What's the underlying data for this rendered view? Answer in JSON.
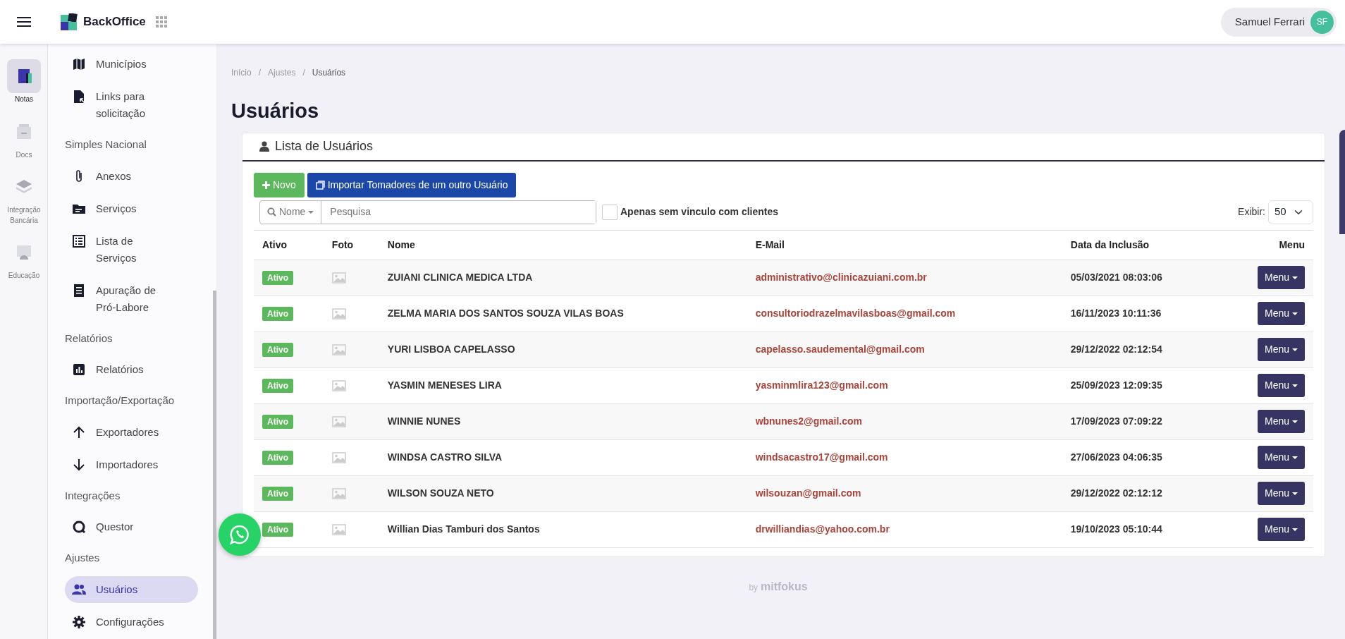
{
  "header": {
    "app_name": "BackOffice",
    "user": {
      "name": "Samuel Ferrari",
      "initials": "SF"
    }
  },
  "rail": [
    {
      "label": "Notas",
      "selected": true
    },
    {
      "label": "Docs",
      "selected": false
    },
    {
      "label": "Integração Bancária",
      "selected": false
    },
    {
      "label": "Educação",
      "selected": false
    }
  ],
  "sidebar": [
    {
      "kind": "item",
      "label": "Municípios",
      "selected": false
    },
    {
      "kind": "item",
      "label": "Links para solicitação",
      "selected": false
    },
    {
      "kind": "heading",
      "label": "Simples Nacional"
    },
    {
      "kind": "item",
      "label": "Anexos",
      "selected": false
    },
    {
      "kind": "item",
      "label": "Serviços",
      "selected": false
    },
    {
      "kind": "item",
      "label": "Lista de Serviços",
      "selected": false
    },
    {
      "kind": "item",
      "label": "Apuração de Pró-Labore",
      "selected": false
    },
    {
      "kind": "heading",
      "label": "Relatórios"
    },
    {
      "kind": "item",
      "label": "Relatórios",
      "selected": false
    },
    {
      "kind": "heading",
      "label": "Importação/Exportação"
    },
    {
      "kind": "item",
      "label": "Exportadores",
      "selected": false
    },
    {
      "kind": "item",
      "label": "Importadores",
      "selected": false
    },
    {
      "kind": "heading",
      "label": "Integrações"
    },
    {
      "kind": "item",
      "label": "Questor",
      "selected": false
    },
    {
      "kind": "heading",
      "label": "Ajustes"
    },
    {
      "kind": "item",
      "label": "Usuários",
      "selected": true
    },
    {
      "kind": "item",
      "label": "Configurações",
      "selected": false
    }
  ],
  "breadcrumb": {
    "separator": "/",
    "items": [
      "Início",
      "Ajustes",
      "Usuários"
    ]
  },
  "page_title": "Usuários",
  "card": {
    "title": "Lista de Usuários",
    "buttons": [
      {
        "kind": "new",
        "label": "Novo"
      },
      {
        "kind": "import",
        "label": "Importar Tomadores de um outro Usuário"
      }
    ],
    "search": {
      "filter": "Nome",
      "placeholder": "Pesquisa"
    },
    "filter_checkbox": {
      "label": "Apenas sem vinculo com clientes",
      "checked": false
    },
    "page_size": {
      "label": "Exibir:",
      "value": "50"
    },
    "table": {
      "columns": [
        "Ativo",
        "Foto",
        "Nome",
        "E-Mail",
        "Data da Inclusão",
        "Menu"
      ],
      "rows": [
        {
          "status": "Ativo",
          "name": "ZUIANI CLINICA MEDICA LTDA",
          "email": "administrativo@clinicazuiani.com.br",
          "date": "05/03/2021 08:03:06",
          "menu": "Menu"
        },
        {
          "status": "Ativo",
          "name": "ZELMA MARIA DOS SANTOS SOUZA VILAS BOAS",
          "email": "consultoriodrazelmavilasboas@gmail.com",
          "date": "16/11/2023 10:11:36",
          "menu": "Menu"
        },
        {
          "status": "Ativo",
          "name": "YURI LISBOA CAPELASSO",
          "email": "capelasso.saudemental@gmail.com",
          "date": "29/12/2022 02:12:54",
          "menu": "Menu"
        },
        {
          "status": "Ativo",
          "name": "YASMIN MENESES LIRA",
          "email": "yasminmlira123@gmail.com",
          "date": "25/09/2023 12:09:35",
          "menu": "Menu"
        },
        {
          "status": "Ativo",
          "name": "WINNIE NUNES",
          "email": "wbnunes2@gmail.com",
          "date": "17/09/2023 07:09:22",
          "menu": "Menu"
        },
        {
          "status": "Ativo",
          "name": "WINDSA CASTRO SILVA",
          "email": "windsacastro17@gmail.com",
          "date": "27/06/2023 04:06:35",
          "menu": "Menu"
        },
        {
          "status": "Ativo",
          "name": "WILSON SOUZA NETO",
          "email": "wilsouzan@gmail.com",
          "date": "29/12/2022 02:12:12",
          "menu": "Menu"
        },
        {
          "status": "Ativo",
          "name": "Willian Dias Tamburi dos Santos",
          "email": "drwilliandias@yahoo.com.br",
          "date": "19/10/2023 05:10:44",
          "menu": "Menu"
        }
      ]
    }
  },
  "footer": {
    "by": "by",
    "brand": "mitfokus"
  }
}
